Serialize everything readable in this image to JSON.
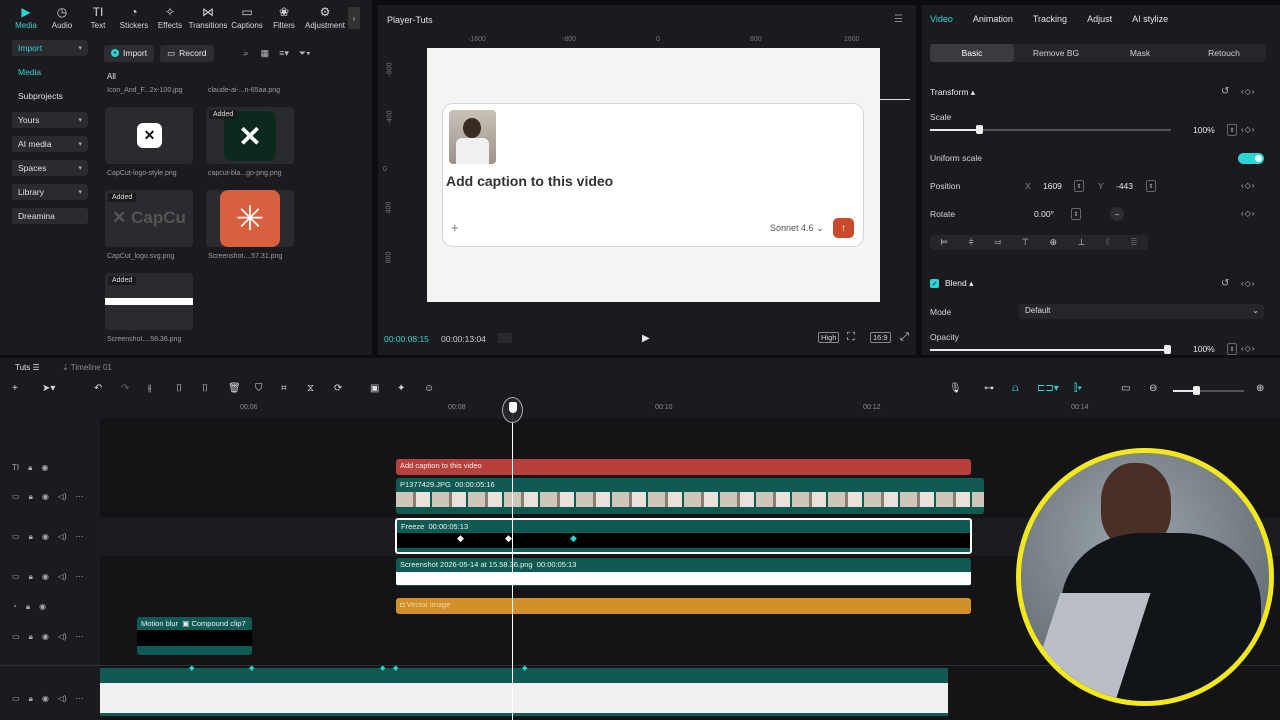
{
  "toolbar": {
    "items": [
      {
        "label": "Media",
        "icon": "media-icon",
        "active": true
      },
      {
        "label": "Audio",
        "icon": "audio-icon"
      },
      {
        "label": "Text",
        "icon": "text-icon"
      },
      {
        "label": "Stickers",
        "icon": "stickers-icon"
      },
      {
        "label": "Effects",
        "icon": "effects-icon"
      },
      {
        "label": "Transitions",
        "icon": "transitions-icon"
      },
      {
        "label": "Captions",
        "icon": "captions-icon"
      },
      {
        "label": "Filters",
        "icon": "filters-icon"
      },
      {
        "label": "Adjustment",
        "icon": "adjustment-icon"
      }
    ]
  },
  "sidebar": {
    "items": [
      "Import",
      "Media",
      "Subprojects",
      "Yours",
      "AI media",
      "Spaces",
      "Library",
      "Dreamina"
    ]
  },
  "media": {
    "import_label": "Import",
    "record_label": "Record",
    "all_label": "All",
    "files": [
      {
        "name": "Icon_And_F...2x-100.jpg"
      },
      {
        "name": "claude-ai-...n-65aa.png"
      },
      {
        "name": "CapCut-logo-style.png"
      },
      {
        "name": "capcut-bla...go-png.png",
        "added": "Added"
      },
      {
        "name": "CapCut_logo.svg.png",
        "added": "Added"
      },
      {
        "name": "Screenshot....57.31.png"
      },
      {
        "name": "Screenshot....58.36.png",
        "added": "Added"
      }
    ]
  },
  "player": {
    "title": "Player-Tuts",
    "ruler_h": [
      "-1600",
      "-800",
      "0",
      "800",
      "1600"
    ],
    "ruler_v": [
      "-800",
      "-400",
      "0",
      "400",
      "800"
    ],
    "caption": "Add caption to this video",
    "model": "Sonnet 4.6",
    "time_current": "00:00:08:15",
    "time_total": "00:00:13:04",
    "quality": "High",
    "ratio": "16:9"
  },
  "inspector": {
    "tabs": [
      "Video",
      "Animation",
      "Tracking",
      "Adjust",
      "AI stylize"
    ],
    "subtabs": [
      "Basic",
      "Remove BG",
      "Mask",
      "Retouch"
    ],
    "transform_label": "Transform",
    "scale_label": "Scale",
    "scale_value": "100%",
    "uniform_label": "Uniform scale",
    "position_label": "Position",
    "pos_x_label": "X",
    "pos_x": "1609",
    "pos_y_label": "Y",
    "pos_y": "-443",
    "rotate_label": "Rotate",
    "rotate_value": "0.00°",
    "blend_label": "Blend",
    "mode_label": "Mode",
    "mode_value": "Default",
    "opacity_label": "Opacity",
    "opacity_value": "100%"
  },
  "timeline": {
    "tab": "Tuts",
    "tab2": "Timeline 01",
    "ruler": [
      "00:06",
      "00:08",
      "00:10",
      "00:12",
      "00:14"
    ],
    "clips": {
      "caption": "Add caption to this video",
      "video": "P1377429.JPG",
      "video_dur": "00:00:05:16",
      "freeze": "Freeze",
      "freeze_dur": "00:00:05:13",
      "shot": "Screenshot 2026-05-14 at 15.58.36.png",
      "shot_dur": "00:00:05:13",
      "vector": "Vector image",
      "motion": "Motion blur",
      "compound": "Compound clip7"
    }
  }
}
